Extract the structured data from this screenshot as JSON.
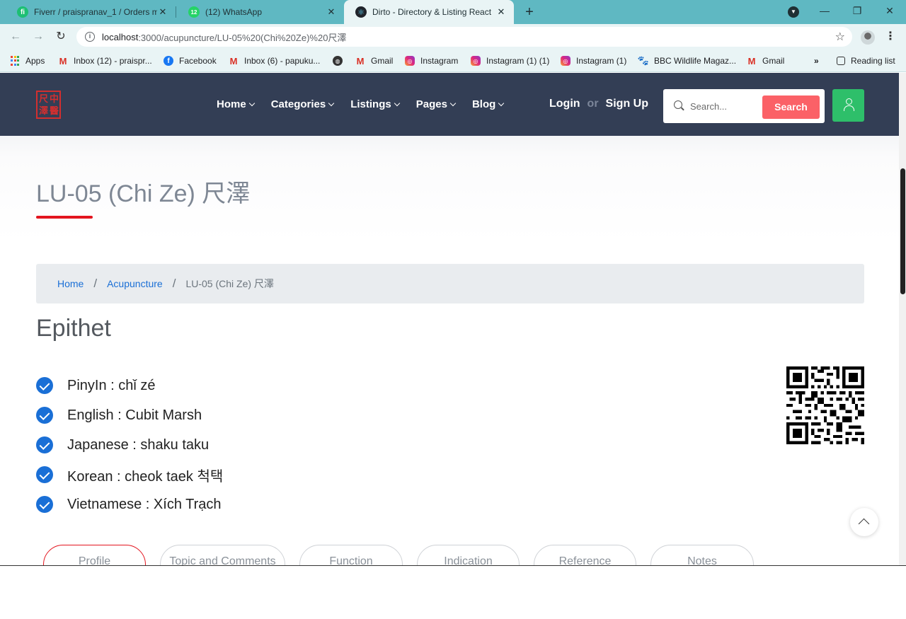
{
  "browser": {
    "tabs": [
      {
        "title": "Fiverr / praispranav_1 / Orders m",
        "icon": "fiverr-icon"
      },
      {
        "title": "(12) WhatsApp",
        "icon": "whatsapp-icon"
      },
      {
        "title": "Dirto - Directory & Listing React",
        "icon": "react-icon"
      }
    ],
    "url_host": "localhost",
    "url_path": ":3000/acupuncture/LU-05%20(Chi%20Ze)%20尺澤",
    "bookmarks": [
      {
        "label": "Apps",
        "icon": "apps-grid-icon"
      },
      {
        "label": "Inbox (12) - praispr...",
        "icon": "gmail-icon"
      },
      {
        "label": "Facebook",
        "icon": "facebook-icon"
      },
      {
        "label": "Inbox (6) - papuku...",
        "icon": "gmail-icon"
      },
      {
        "label": "",
        "icon": "globe-icon"
      },
      {
        "label": "Gmail",
        "icon": "gmail-icon"
      },
      {
        "label": "Instagram",
        "icon": "instagram-icon"
      },
      {
        "label": "Instagram (1) (1)",
        "icon": "instagram-icon"
      },
      {
        "label": "Instagram (1)",
        "icon": "instagram-icon"
      },
      {
        "label": "BBC Wildlife Magaz...",
        "icon": "paw-icon"
      },
      {
        "label": "Gmail",
        "icon": "gmail-icon"
      }
    ],
    "bookmarks_more": "»",
    "reading_list": "Reading list"
  },
  "header": {
    "logo_chars": [
      "尺",
      "中",
      "澤",
      "醫"
    ],
    "nav": [
      "Home",
      "Categories",
      "Listings",
      "Pages",
      "Blog"
    ],
    "login": "Login",
    "or": "or",
    "signup": "Sign Up",
    "search_placeholder": "Search...",
    "search_button": "Search"
  },
  "page": {
    "title": "LU-05 (Chi Ze) 尺澤",
    "breadcrumb": {
      "home": "Home",
      "section": "Acupuncture",
      "current": "LU-05 (Chi Ze) 尺澤"
    },
    "section_title": "Epithet",
    "epithets": [
      "PinyIn : chǐ zé",
      "English : Cubit Marsh",
      "Japanese : shaku taku",
      "Korean : cheok taek 척택",
      "Vietnamese : Xích Trạch"
    ],
    "tabs": [
      "Profile",
      "Topic and Comments",
      "Function",
      "Indication",
      "Reference",
      "Notes"
    ],
    "active_tab": "Profile"
  },
  "colors": {
    "header_bg": "#333e55",
    "accent_red": "#e3151f",
    "search_button": "#fb6167",
    "user_button": "#2ebf6a",
    "link_blue": "#1a6fd6"
  }
}
